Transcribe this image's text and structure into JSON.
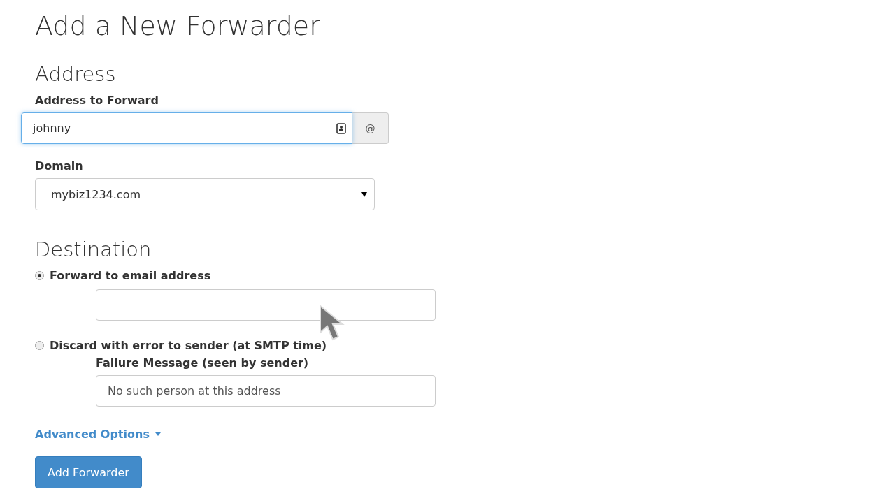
{
  "title": "Add a New Forwarder",
  "address": {
    "heading": "Address",
    "forward_label": "Address to Forward",
    "forward_value": "johnny",
    "addon": "@",
    "domain_label": "Domain",
    "domain_value": "mybiz1234.com"
  },
  "destination": {
    "heading": "Destination",
    "options": [
      {
        "kind": "email",
        "label": "Forward to email address",
        "selected": true
      },
      {
        "kind": "discard",
        "label": "Discard with error to sender (at SMTP time)",
        "selected": false,
        "sub_label": "Failure Message (seen by sender)",
        "value": "No such person at this address"
      }
    ]
  },
  "advanced_link": "Advanced Options",
  "submit": "Add Forwarder"
}
